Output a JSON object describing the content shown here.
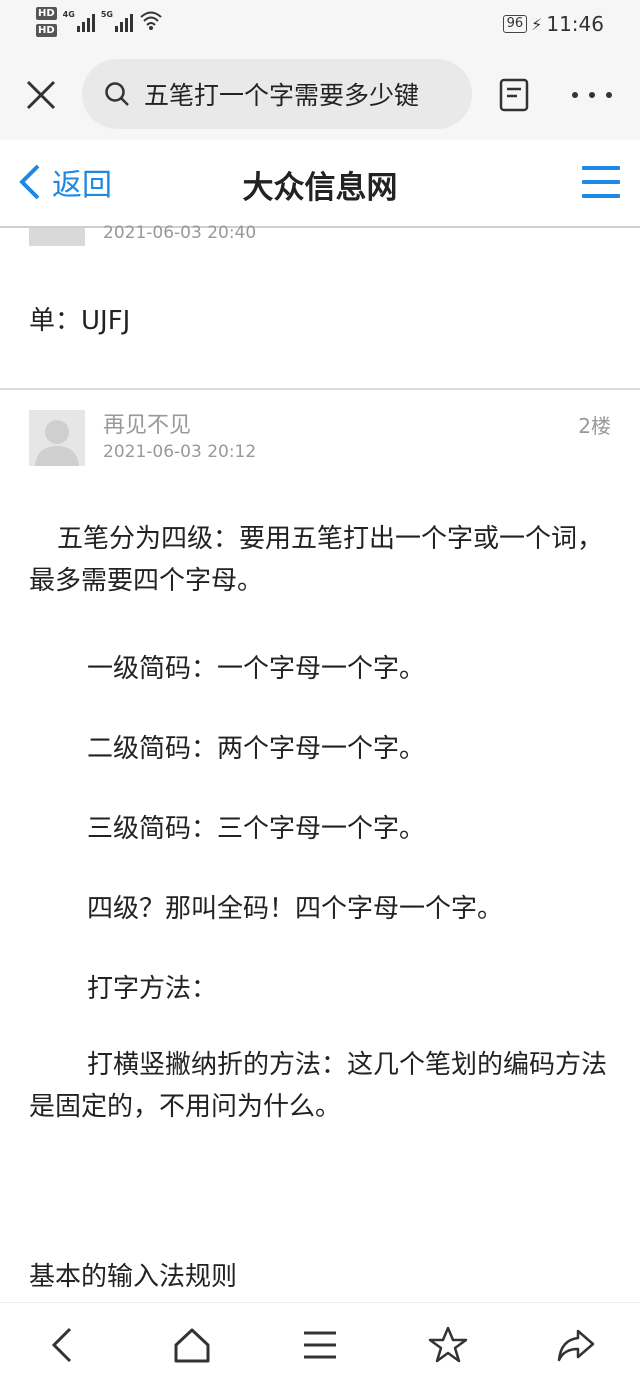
{
  "status_bar": {
    "hd1": "HD",
    "hd2": "HD",
    "net1": "4G",
    "net2": "5G",
    "battery": "96",
    "time": "11:46"
  },
  "browser": {
    "search_text": "五笔打一个字需要多少键",
    "icons": [
      "close-icon",
      "search-icon",
      "reader-mode-icon",
      "more-icon"
    ]
  },
  "site": {
    "back_label": "返回",
    "title": "大众信息网",
    "accent": "#1e88e5"
  },
  "prev_post": {
    "time": "2021-06-03 20:40",
    "snippet": "单：UJFJ"
  },
  "post": {
    "username": "再见不见",
    "time": "2021-06-03 20:12",
    "floor": "2楼",
    "paragraphs": [
      "五笔分为四级：要用五笔打出一个字或一个词，最多需要四个字母。",
      "一级简码：一个字母一个字。",
      "二级简码：两个字母一个字。",
      "三级简码：三个字母一个字。",
      "四级？那叫全码！四个字母一个字。",
      "打字方法：",
      "打横竖撇纳折的方法：这几个笔划的编码方法是固定的，不用问为什么。",
      "基本的输入法规则"
    ]
  },
  "bottom_nav": [
    "back-icon",
    "home-icon",
    "menu-icon",
    "star-icon",
    "share-icon"
  ]
}
